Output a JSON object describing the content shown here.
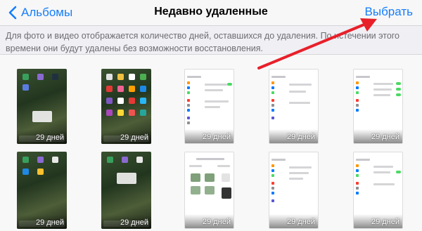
{
  "nav": {
    "back_label": "Альбомы",
    "title": "Недавно удаленные",
    "select_label": "Выбрать"
  },
  "info_text": "Для фото и видео отображается количество дней, оставшихся до удаления. По истечении этого времени они будут удалены без возможности восстановления.",
  "thumbnails": [
    {
      "kind": "home",
      "days": "29 дней"
    },
    {
      "kind": "home",
      "days": "29 дней"
    },
    {
      "kind": "settings",
      "days": "29 дней"
    },
    {
      "kind": "settings",
      "days": "29 дней"
    },
    {
      "kind": "settings",
      "days": "29 дней"
    },
    {
      "kind": "home",
      "days": "29 дней"
    },
    {
      "kind": "home",
      "days": "29 дней"
    },
    {
      "kind": "settings",
      "days": "29 дней"
    },
    {
      "kind": "settings",
      "days": "29 дней"
    },
    {
      "kind": "settings",
      "days": "29 дней"
    }
  ],
  "colors": {
    "accent": "#157efb",
    "annotation_arrow": "#e8202a"
  }
}
